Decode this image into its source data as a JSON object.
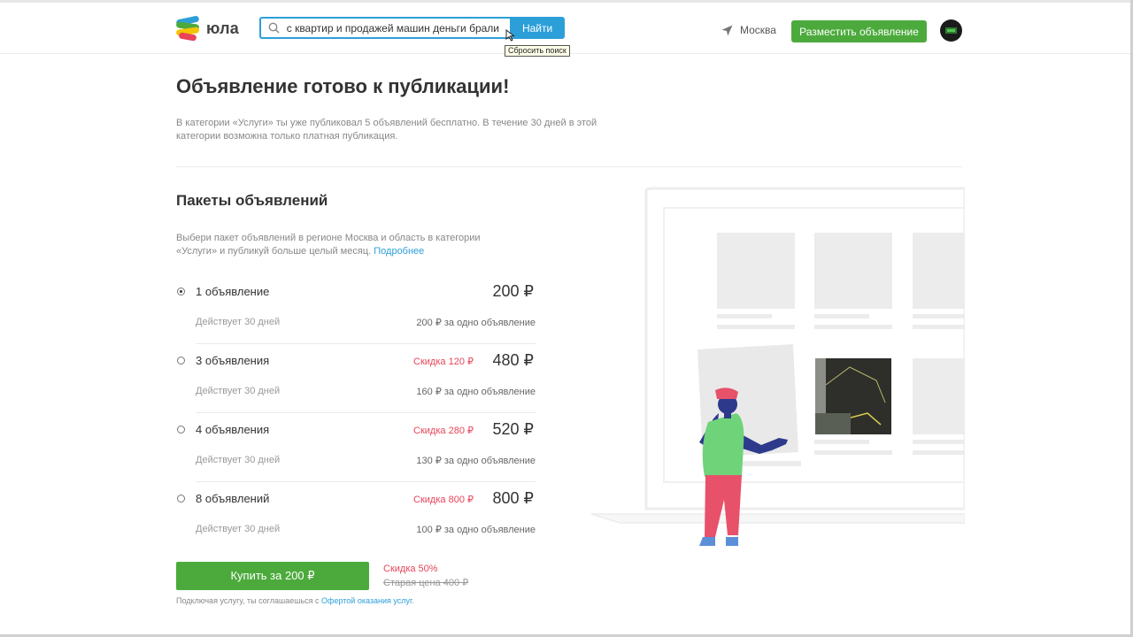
{
  "header": {
    "logo_text": "юла",
    "search_value": "с квартир и продажей машин деньги брали",
    "search_button": "Найти",
    "reset_tooltip": "Сбросить поиск",
    "city": "Москва",
    "post_button": "Разместить объявление"
  },
  "main": {
    "title": "Объявление готово к публикации!",
    "intro": "В категории «Услуги» ты уже публиковал 5 объявлений бесплатно. В течение 30 дней в этой категории возможна только платная публикация.",
    "section_title": "Пакеты объявлений",
    "section_desc": "Выбери пакет объявлений в регионе Москва и область в категории «Услуги» и публикуй больше целый месяц.",
    "more_link": "Подробнее"
  },
  "packages": [
    {
      "name": "1 объявление",
      "discount": "",
      "price": "200 ₽",
      "validity": "Действует 30 дней",
      "per_unit": "200 ₽ за одно объявление",
      "selected": true
    },
    {
      "name": "3 объявления",
      "discount": "Скидка 120 ₽",
      "price": "480 ₽",
      "validity": "Действует 30 дней",
      "per_unit": "160 ₽ за одно объявление",
      "selected": false
    },
    {
      "name": "4 объявления",
      "discount": "Скидка 280 ₽",
      "price": "520 ₽",
      "validity": "Действует 30 дней",
      "per_unit": "130 ₽ за одно объявление",
      "selected": false
    },
    {
      "name": "8 объявлений",
      "discount": "Скидка 800 ₽",
      "price": "800 ₽",
      "validity": "Действует 30 дней",
      "per_unit": "100 ₽ за одно объявление",
      "selected": false
    }
  ],
  "purchase": {
    "button": "Купить за 200 ₽",
    "discount": "Скидка 50%",
    "old_price": "Старая цена 400 ₽",
    "terms_prefix": "Подключая услугу, ты соглашаешься с",
    "terms_link": "Офертой оказания услуг",
    "terms_suffix": "."
  },
  "icons": {
    "search": "search-icon",
    "location": "location-arrow-icon",
    "radio": "radio-icon"
  },
  "colors": {
    "accent_blue": "#2d9fd8",
    "green": "#4caa3c",
    "discount_red": "#e8445a"
  }
}
